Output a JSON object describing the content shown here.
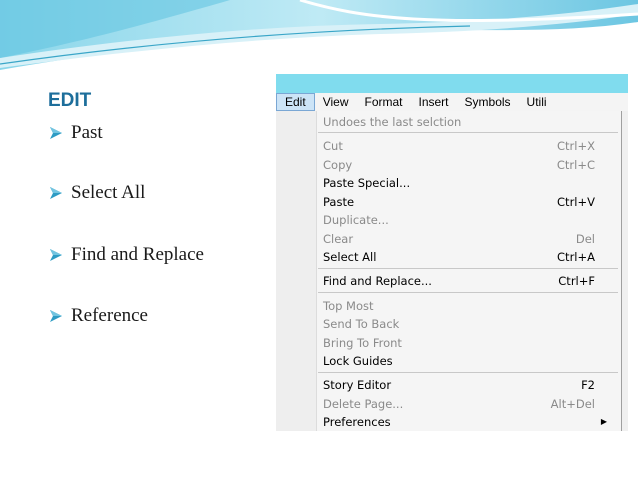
{
  "slide": {
    "title": "EDIT",
    "bullets": [
      "Past",
      "Select  All",
      "Find and Replace",
      "Reference"
    ]
  },
  "menu_bar": [
    "Edit",
    "View",
    "Format",
    "Insert",
    "Symbols",
    "Utili"
  ],
  "edit_menu": {
    "undo": "Undoes the last selction",
    "cut": {
      "label": "Cut",
      "shortcut": "Ctrl+X"
    },
    "copy": {
      "label": "Copy",
      "shortcut": "Ctrl+C"
    },
    "paste_special": {
      "label": "Paste Special...",
      "shortcut": ""
    },
    "paste": {
      "label": "Paste",
      "shortcut": "Ctrl+V"
    },
    "duplicate": {
      "label": "Duplicate...",
      "shortcut": ""
    },
    "clear": {
      "label": "Clear",
      "shortcut": "Del"
    },
    "select_all": {
      "label": "Select All",
      "shortcut": "Ctrl+A"
    },
    "find_replace": {
      "label": "Find and Replace...",
      "shortcut": "Ctrl+F"
    },
    "top_most": {
      "label": "Top Most",
      "shortcut": ""
    },
    "send_to_back": {
      "label": "Send To Back",
      "shortcut": ""
    },
    "bring_to_front": {
      "label": "Bring To Front",
      "shortcut": ""
    },
    "lock_guides": {
      "label": "Lock Guides",
      "shortcut": ""
    },
    "story_editor": {
      "label": "Story Editor",
      "shortcut": "F2"
    },
    "delete_page": {
      "label": "Delete Page...",
      "shortcut": "Alt+Del"
    },
    "preferences": {
      "label": "Preferences",
      "shortcut": ""
    }
  },
  "colors": {
    "title": "#1d6e9b",
    "bullet_arrow": "#2d9bc4",
    "screenshot_bar": "#80dcee",
    "disabled_text": "#8a8a8a"
  },
  "icons": {
    "bullet": "arrow-bullet-icon",
    "submenu": "submenu-arrow-icon"
  }
}
